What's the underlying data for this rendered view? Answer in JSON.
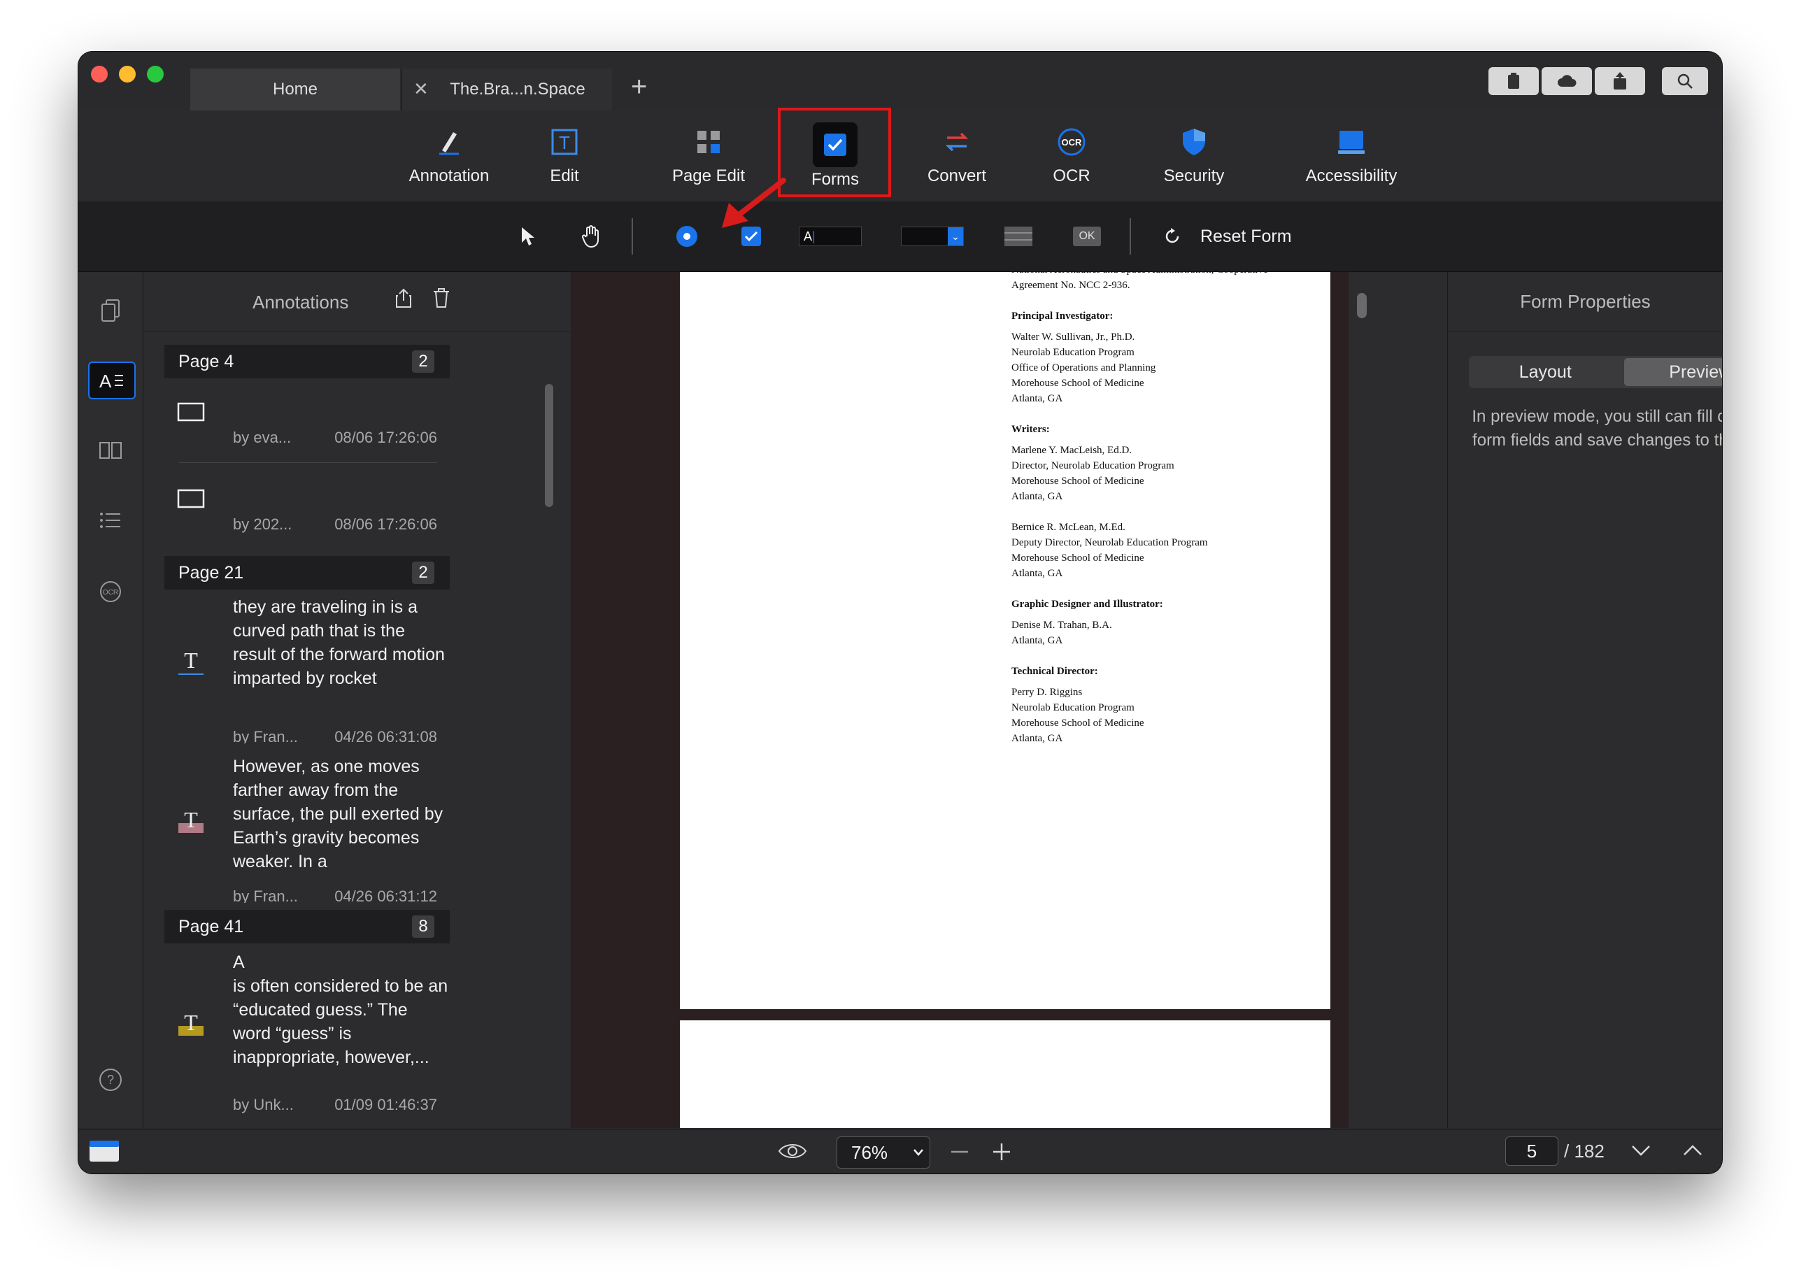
{
  "tabs": [
    {
      "label": "Home"
    },
    {
      "label": "The.Bra...n.Space"
    }
  ],
  "toolbar": {
    "items": [
      {
        "label": "Annotation"
      },
      {
        "label": "Edit"
      },
      {
        "label": "Page Edit"
      },
      {
        "label": "Forms"
      },
      {
        "label": "Convert"
      },
      {
        "label": "OCR"
      },
      {
        "label": "Security"
      },
      {
        "label": "Accessibility"
      }
    ]
  },
  "form_toolbar": {
    "text_field_sample": "A",
    "button_sample": "OK",
    "reset_label": "Reset Form"
  },
  "annotations": {
    "title": "Annotations",
    "groups": [
      {
        "page": "Page 4",
        "count": "2",
        "items": [
          {
            "text": "",
            "author": "by eva...",
            "date": "08/06 17:26:06"
          },
          {
            "text": "",
            "author": "by 202...",
            "date": "08/06 17:26:06"
          }
        ]
      },
      {
        "page": "Page 21",
        "count": "2",
        "items": [
          {
            "text": "they are traveling in is a curved path that is the result of the forward motion imparted by rocket",
            "author": "by Fran...",
            "date": "04/26 06:31:08"
          },
          {
            "text": "However, as one moves farther away from the surface, the pull exerted by Earth’s gravity becomes weaker. In a",
            "author": "by Fran...",
            "date": "04/26 06:31:12"
          }
        ]
      },
      {
        "page": "Page 41",
        "count": "8",
        "items": [
          {
            "text": "A\nis often considered to be an “educated guess.” The word “guess” is inappropriate, however,...",
            "author": "by Unk...",
            "date": "01/09 01:46:37"
          }
        ]
      }
    ]
  },
  "document": {
    "top_partial": "National Aeronautics and Space Administration, Cooperative",
    "agreement": "Agreement No. NCC 2-936.",
    "sections": [
      {
        "heading": "Principal Investigator:",
        "blocks": [
          [
            "Walter W. Sullivan, Jr., Ph.D.",
            "Neurolab Education Program",
            "Office of Operations and Planning",
            "Morehouse School of Medicine",
            "Atlanta, GA"
          ]
        ]
      },
      {
        "heading": "Writers:",
        "blocks": [
          [
            "Marlene Y. MacLeish, Ed.D.",
            "Director, Neurolab Education Program",
            "Morehouse School of Medicine",
            "Atlanta, GA"
          ],
          [
            "Bernice R. McLean, M.Ed.",
            "Deputy Director, Neurolab Education Program",
            "Morehouse School of Medicine",
            "Atlanta, GA"
          ]
        ]
      },
      {
        "heading": "Graphic Designer and Illustrator:",
        "blocks": [
          [
            "Denise M. Trahan, B.A.",
            "Atlanta, GA"
          ]
        ]
      },
      {
        "heading": "Technical Director:",
        "blocks": [
          [
            "Perry D. Riggins",
            "Neurolab Education Program",
            "Morehouse School of Medicine",
            "Atlanta, GA"
          ]
        ]
      }
    ]
  },
  "form_properties": {
    "title": "Form Properties",
    "tabs": [
      "Layout",
      "Preview"
    ],
    "active_tab": "Preview",
    "description": "In preview mode, you still can fill out the form fields and save changes to the file."
  },
  "status": {
    "zoom": "76%",
    "current_page": "5",
    "total_pages": "/ 182"
  },
  "colors": {
    "accent_blue": "#1a73e8",
    "highlight_red": "#e01818",
    "arrow_red": "#d81b1b"
  }
}
